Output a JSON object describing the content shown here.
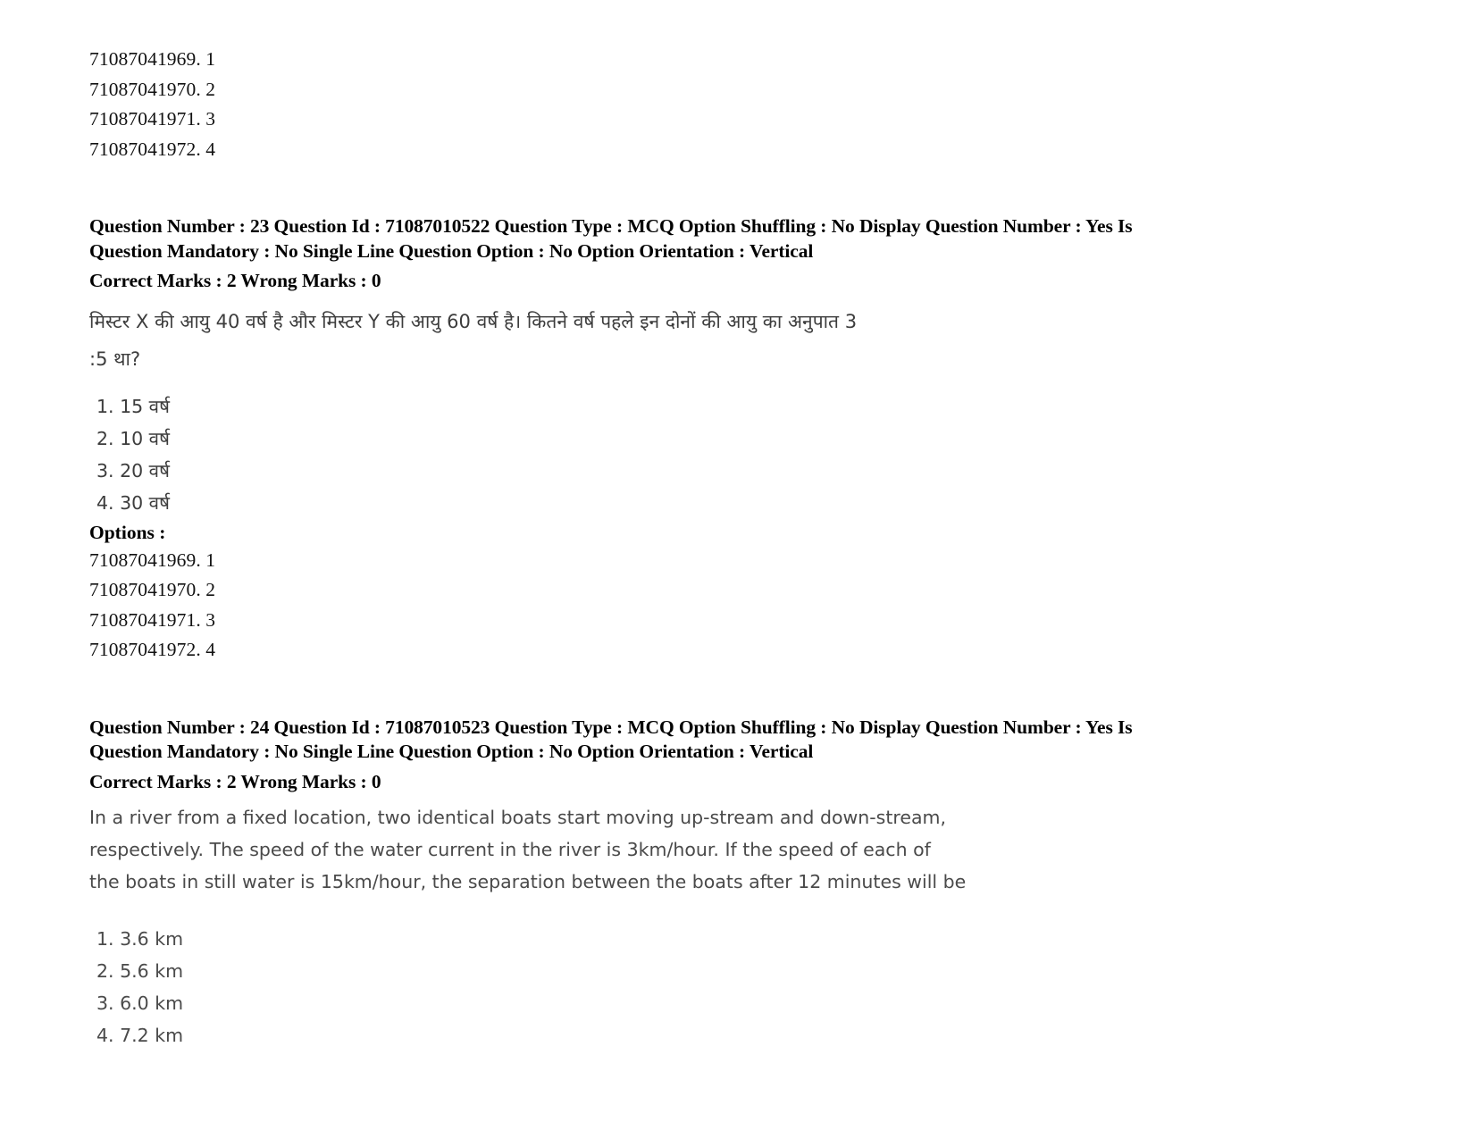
{
  "document": {
    "type": "exam-question-paper",
    "page_background": "#ffffff",
    "text_color_meta": "#000000",
    "text_color_body": "#4a4a4a"
  },
  "top_option_ids": [
    "71087041969. 1",
    "71087041970. 2",
    "71087041971. 3",
    "71087041972. 4"
  ],
  "questions": [
    {
      "meta_line_1": "Question Number : 23 Question Id : 71087010522 Question Type : MCQ Option Shuffling : No Display Question Number : Yes Is",
      "meta_line_2": "Question Mandatory : No Single Line Question Option : No Option Orientation : Vertical",
      "marks_line": "Correct Marks : 2 Wrong Marks : 0",
      "body_lines": [
        "मिस्टर X की आयु 40 वर्ष है और मिस्टर Y की आयु 60 वर्ष है। कितने वर्ष पहले इन दोनों की आयु का अनुपात 3",
        ":5 था?"
      ],
      "language": "hi",
      "answers": [
        "1. 15 वर्ष",
        "2. 10 वर्ष",
        "3. 20 वर्ष",
        "4. 30 वर्ष"
      ],
      "options_label": "Options :",
      "option_ids": [
        "71087041969. 1",
        "71087041970. 2",
        "71087041971. 3",
        "71087041972. 4"
      ]
    },
    {
      "meta_line_1": "Question Number : 24 Question Id : 71087010523 Question Type : MCQ Option Shuffling : No Display Question Number : Yes Is",
      "meta_line_2": "Question Mandatory : No Single Line Question Option : No Option Orientation : Vertical",
      "marks_line": "Correct Marks : 2 Wrong Marks : 0",
      "body_lines": [
        "In a river from a fixed location, two identical boats start moving up-stream and down-stream,",
        "respectively. The speed of the water current in the river is 3km/hour. If the speed of each of",
        "the boats in still water is 15km/hour, the separation between the boats after 12 minutes will be"
      ],
      "language": "en",
      "answers": [
        "1. 3.6 km",
        "2. 5.6 km",
        "3. 6.0 km",
        "4. 7.2 km"
      ]
    }
  ]
}
